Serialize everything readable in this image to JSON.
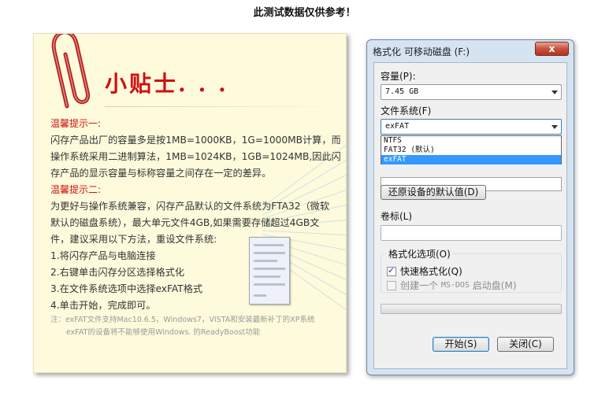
{
  "header": {
    "note": "此测试数据仅供参考！"
  },
  "tips": {
    "title": "小贴士. . .",
    "tip1_heading": "温馨提示一:",
    "tip1_body": "闪存产品出厂的容量多是按1MB=1000KB，1G=1000MB计算，而操作系统采用二进制算法，1MB=1024KB，1GB=1024MB,因此闪存产品的显示容量与标称容量之间存在一定的差异。",
    "tip2_heading": "温馨提示二:",
    "tip2_body": "为更好与操作系统兼容，闪存产品默认的文件系统为FTA32（微软默认的磁盘系统），最大单元文件4GB,如果需要存储超过4GB文件，建议采用以下方法，重设文件系统:",
    "steps": [
      "1.将闪存产品与电脑连接",
      "2.右键单击闪存分区选择格式化",
      "3.在文件系统选项中选择exFAT格式",
      "4.单击开始，完成即可。"
    ],
    "note_line1": "注：exFAT文件支持Mac10.6.5，Windows7，VISTA和安装最新补丁的XP系统",
    "note_line2": "exFAT的设备将不能够使用Windows. 的ReadyBoost功能"
  },
  "dialog": {
    "title": "格式化 可移动磁盘 (F:)",
    "close_label": "x",
    "capacity_label": "容量(P):",
    "capacity_value": "7.45 GB",
    "filesystem_label": "文件系统(F)",
    "filesystem_value": "exFAT",
    "filesystem_options": [
      "NTFS",
      "FAT32 (默认)",
      "exFAT"
    ],
    "restore_defaults_label": "还原设备的默认值(D)",
    "volume_label": "卷标(L)",
    "volume_value": "",
    "format_options_label": "格式化选项(O)",
    "quick_format_label": "快速格式化(Q)",
    "quick_format_checked": true,
    "msdos_label_prefix": "创建一个",
    "msdos_label_mono": "MS-DOS",
    "msdos_label_suffix": "启动盘(M)",
    "msdos_checked": false,
    "progress": 0,
    "start_label": "开始(S)",
    "close_button_label": "关闭(C)"
  }
}
